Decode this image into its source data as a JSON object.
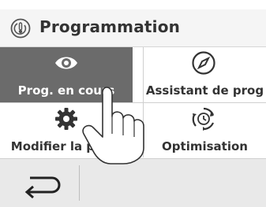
{
  "header": {
    "title": "Programmation",
    "icon": "clock-thermometer-icon"
  },
  "tiles": [
    {
      "label": "Prog. en cours",
      "icon": "eye-icon",
      "active": true
    },
    {
      "label": "Assistant de prog",
      "icon": "compass-icon",
      "active": false
    },
    {
      "label": "Modifier la prog.",
      "icon": "gear-icon",
      "active": false
    },
    {
      "label": "Optimisation",
      "icon": "clock-cycle-icon",
      "active": false
    }
  ],
  "footer": {
    "back_icon": "back-arrow-icon"
  },
  "colors": {
    "active_tile": "#6b6b6b",
    "header_bg": "#f5f5f5",
    "footer_bg": "#e9e9e9",
    "text": "#333333"
  }
}
